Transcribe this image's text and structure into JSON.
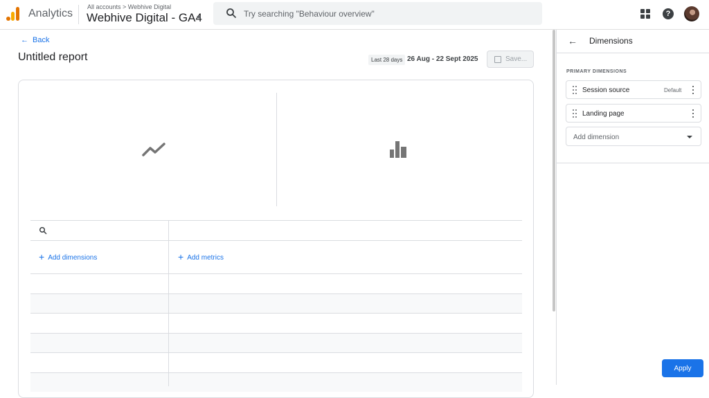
{
  "header": {
    "app_name": "Analytics",
    "breadcrumb": "All accounts > Webhive Digital",
    "property": "Webhive Digital - GA4",
    "search_placeholder": "Try searching \"Behaviour overview\""
  },
  "report": {
    "back_label": "Back",
    "title": "Untitled report",
    "date_label": "Last 28 days",
    "date_range": "26 Aug - 22 Sept 2025",
    "save_label": "Save..."
  },
  "table": {
    "add_dimensions": "Add dimensions",
    "add_metrics": "Add metrics"
  },
  "panel": {
    "title": "Dimensions",
    "section_label": "PRIMARY DIMENSIONS",
    "dimensions": [
      {
        "name": "Session source",
        "badge": "Default"
      },
      {
        "name": "Landing page",
        "badge": ""
      }
    ],
    "add_dimension": "Add dimension",
    "apply_label": "Apply"
  },
  "colors": {
    "accent": "#1a73e8",
    "logo_orange": "#e37400",
    "logo_yellow": "#f9ab00"
  }
}
